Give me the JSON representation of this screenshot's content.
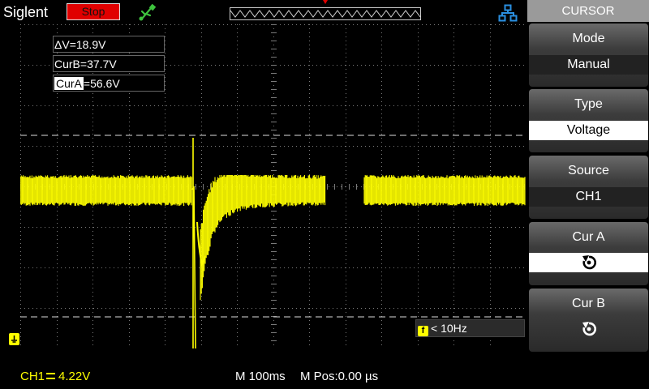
{
  "header": {
    "brand": "Siglent",
    "run_status": "Stop",
    "icons": [
      "usb-icon",
      "network-icon"
    ]
  },
  "cursor_readouts": {
    "delta_v": "ΔV=18.9V",
    "cur_b": "CurB=37.7V",
    "cur_a_label": "CurA",
    "cur_a_value": "=56.6V"
  },
  "trigger": {
    "freq_icon": "f",
    "freq_text": "< 10Hz"
  },
  "status_bar": {
    "ch1_label": "CH1",
    "ch1_scale": "4.22V",
    "timebase": "M 100ms",
    "mpos": "M Pos:0.00 µs"
  },
  "menu": {
    "title": "CURSOR",
    "mode_label": "Mode",
    "mode_value": "Manual",
    "type_label": "Type",
    "type_value": "Voltage",
    "source_label": "Source",
    "source_value": "CH1",
    "cur_a_label": "Cur A",
    "cur_b_label": "Cur B",
    "knob_icon": "rotate-knob-icon"
  },
  "colors": {
    "trace": "#ffff00",
    "stop": "#e00000",
    "grid": "#7a7a7a"
  }
}
